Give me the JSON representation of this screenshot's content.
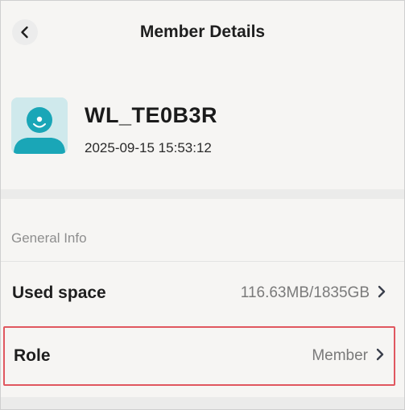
{
  "header": {
    "title": "Member Details",
    "back_icon": "chevron-left-icon"
  },
  "profile": {
    "avatar_icon": "user-avatar-icon",
    "name": "WL_TE0B3R",
    "date": "2025-09-15 15:53:12"
  },
  "sections": {
    "general_info_label": "General Info"
  },
  "rows": {
    "used_space": {
      "label": "Used space",
      "value": "116.63MB/1835GB",
      "icon": "chevron-right-icon"
    },
    "role": {
      "label": "Role",
      "value": "Member",
      "icon": "chevron-right-icon",
      "highlighted": true
    }
  },
  "colors": {
    "background": "#f6f5f3",
    "avatar_bg": "#cfe9ec",
    "avatar_fg": "#1aa6b7",
    "highlight_border": "#e0575f"
  }
}
